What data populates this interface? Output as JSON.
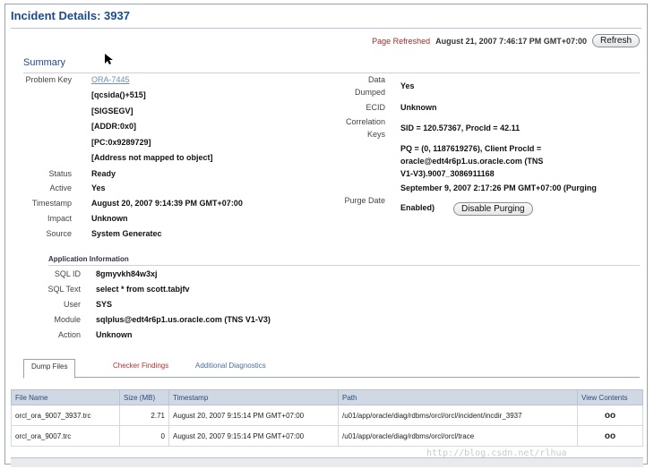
{
  "page": {
    "title": "Incident Details: 3937"
  },
  "refresh": {
    "label": "Page Refreshed",
    "timestamp": "August 21, 2007 7:46:17 PM GMT+07:00",
    "button": "Refresh"
  },
  "summary": {
    "title": "Summary"
  },
  "left": {
    "problem_key_label": "Problem Key",
    "problem_key_link": "ORA-7445",
    "problem_key_lines": [
      "[qcsida()+515]",
      "[SIGSEGV]",
      "[ADDR:0x0]",
      "[PC:0x9289729]",
      "[Address not mapped to object]"
    ],
    "status_label": "Status",
    "status_value": "Ready",
    "active_label": "Active",
    "active_value": "Yes",
    "timestamp_label": "Timestamp",
    "timestamp_value": "August 20, 2007 9:14:39 PM GMT+07:00",
    "impact_label": "Impact",
    "impact_value": "Unknown",
    "source_label": "Source",
    "source_value": "System Generatec"
  },
  "right": {
    "data_dumped_label_1": "Data",
    "data_dumped_label_2": "Dumped",
    "data_dumped_value": "Yes",
    "ecid_label": "ECID",
    "ecid_value": "Unknown",
    "corr_label_1": "Correlation",
    "corr_label_2": "Keys",
    "corr_line_1": "SID = 120.57367, ProcId = 42.11",
    "corr_line_2": "PQ = (0, 1187619276), Client ProcId =",
    "corr_line_3": "oracle@edt4r6p1.us.oracle.com (TNS",
    "corr_line_4": "V1-V3).9007_3086911168",
    "purge_label": "Purge Date",
    "purge_line_1": "September 9, 2007 2:17:26 PM GMT+07:00 (Purging",
    "purge_line_2": "Enabled)",
    "purge_button": "Disable Purging"
  },
  "app_info": {
    "heading": "Application Information",
    "sql_id_label": "SQL ID",
    "sql_id_value": "8gmyvkh84w3xj",
    "sql_text_label": "SQL Text",
    "sql_text_value": "select * from scott.tabjfv",
    "user_label": "User",
    "user_value": "SYS",
    "module_label": "Module",
    "module_value": "sqlplus@edt4r6p1.us.oracle.com (TNS V1-V3)",
    "action_label": "Action",
    "action_value": "Unknown"
  },
  "tabs": [
    "Dump Files",
    "Checker Findings",
    "Additional Diagnostics"
  ],
  "table": {
    "headers": [
      "File Name",
      "Size (MB)",
      "Timestamp",
      "Path",
      "View Contents"
    ],
    "rows": [
      [
        "orcl_ora_9007_3937.trc",
        "2.71",
        "August 20, 2007 9:15:14 PM GMT+07:00",
        "/u01/app/oracle/diag/rdbms/orcl/orcl/incident/incdir_3937",
        "oo"
      ],
      [
        "orcl_ora_9007.trc",
        "0",
        "August 20, 2007 9:15:14 PM GMT+07:00",
        "/u01/app/oracle/diag/rdbms/orcl/orcl/trace",
        "oo"
      ]
    ]
  },
  "watermark": "http://blog.csdn.net/rlhua"
}
